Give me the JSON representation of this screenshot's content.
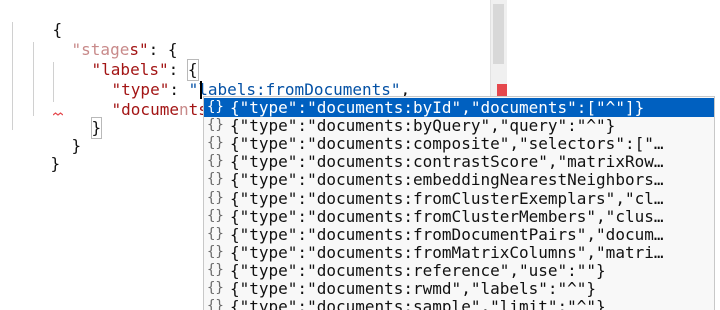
{
  "editor": {
    "lines": {
      "l1": "{",
      "l2_key_a": "\"stage",
      "l2_key_b": "s\"",
      "l2_rest": ": {",
      "l3_key": "\"labels\"",
      "l3_colon": ": ",
      "l3_brace": "{",
      "l4_key": "\"type\"",
      "l4_colon": ": ",
      "l4_value": "\"labels:fromDocuments\"",
      "l4_comma": ",",
      "l5_key_a": "\"docume",
      "l5_key_b": "n",
      "l5_key_c": "ts\"",
      "l5_colon": ": ",
      "l6": "}",
      "l7": "}",
      "l8": "}"
    }
  },
  "suggest": {
    "icon": "{}",
    "icon_name": "braces-icon",
    "items": [
      "{\"type\":\"documents:byId\",\"documents\":[\"^\"]}",
      "{\"type\":\"documents:byQuery\",\"query\":\"^\"}",
      "{\"type\":\"documents:composite\",\"selectors\":[\"…",
      "{\"type\":\"documents:contrastScore\",\"matrixRow…",
      "{\"type\":\"documents:embeddingNearestNeighbors…",
      "{\"type\":\"documents:fromClusterExemplars\",\"cl…",
      "{\"type\":\"documents:fromClusterMembers\",\"clus…",
      "{\"type\":\"documents:fromDocumentPairs\",\"docum…",
      "{\"type\":\"documents:fromMatrixColumns\",\"matri…",
      "{\"type\":\"documents:reference\",\"use\":\"\"}",
      "{\"type\":\"documents:rwmd\",\"labels\":\"^\"}",
      "{\"type\":\"documents:sample\",\"limit\":\"^\"}"
    ],
    "selected_index": 0
  },
  "colors": {
    "key": "#a31515",
    "string": "#0451a5",
    "selection": "#0060c0",
    "error_marker": "#e5484d"
  }
}
